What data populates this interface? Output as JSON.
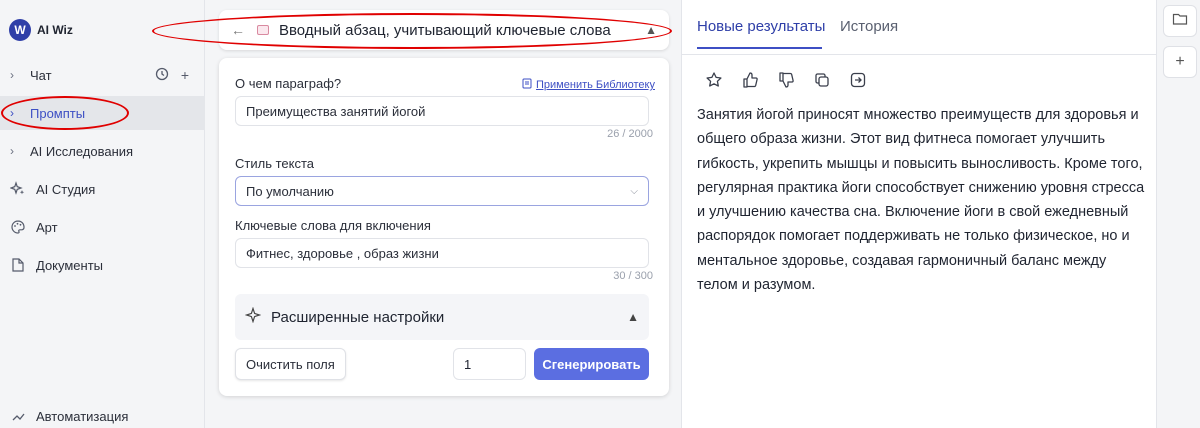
{
  "app": {
    "logo_text": "AI Wiz",
    "logo_mark": "W"
  },
  "sidebar": {
    "items": [
      {
        "label": "Чат",
        "icon": "chevron-right"
      },
      {
        "label": "Промпты",
        "icon": "chevron-right"
      },
      {
        "label": "AI Исследования",
        "icon": "chevron-right"
      },
      {
        "label": "AI Студия",
        "icon": "sparkle-icon"
      },
      {
        "label": "Арт",
        "icon": "palette-icon"
      },
      {
        "label": "Документы",
        "icon": "document-icon"
      },
      {
        "label": "Автоматизация",
        "icon": "automation-icon"
      }
    ]
  },
  "prompt": {
    "title": "Вводный абзац, учитывающий ключевые слова",
    "paragraph_label": "О чем параграф?",
    "library_link": "Применить Библиотеку",
    "paragraph_value": "Преимущества занятий йогой",
    "paragraph_counter": "26 / 2000",
    "style_label": "Стиль текста",
    "style_value": "По умолчанию",
    "keywords_label": "Ключевые слова для включения",
    "keywords_value": "Фитнес, здоровье , образ жизни",
    "keywords_counter": "30 / 300",
    "advanced_label": "Расширенные настройки",
    "clear_button": "Очистить поля",
    "count_value": "1",
    "generate_button": "Сгенерировать"
  },
  "results": {
    "tabs": [
      "Новые результаты",
      "История"
    ],
    "active_tab": 0,
    "text": "Занятия йогой приносят множество преимуществ для здоровья и общего образа жизни. Этот вид фитнеса помогает улучшить гибкость, укрепить мышцы и повысить выносливость. Кроме того, регулярная практика йоги способствует снижению уровня стресса и улучшению качества сна. Включение йоги в свой ежедневный распорядок помогает поддерживать не только физическое, но и ментальное здоровье, создавая гармоничный баланс между телом и разумом.",
    "actions": [
      "star-icon",
      "thumbs-up-icon",
      "thumbs-down-icon",
      "copy-icon",
      "export-icon"
    ]
  },
  "colors": {
    "accent": "#3d4fc4",
    "generate_button": "#5b6ee1",
    "annotation": "#e00000"
  }
}
